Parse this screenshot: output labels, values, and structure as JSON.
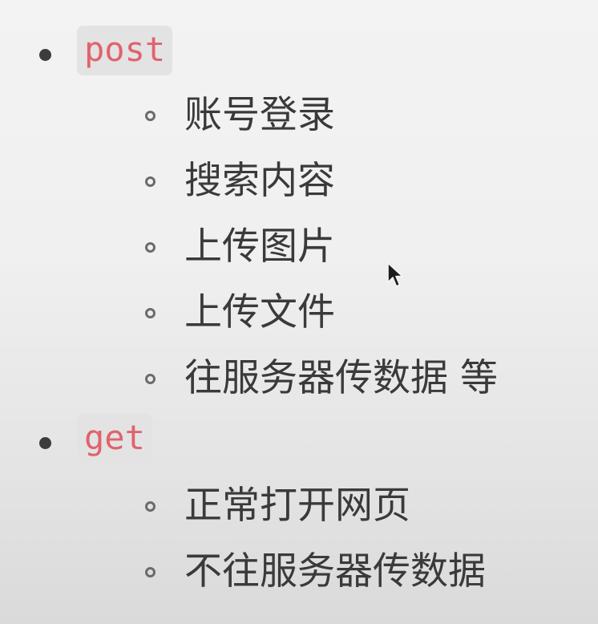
{
  "lists": [
    {
      "code": "post",
      "items": [
        "账号登录",
        "搜索内容",
        "上传图片",
        "上传文件",
        "往服务器传数据 等"
      ]
    },
    {
      "code": "get",
      "items": [
        "正常打开网页",
        "不往服务器传数据"
      ]
    }
  ],
  "colors": {
    "code_text": "#e0636d",
    "code_background": "#e3e3e3",
    "body_text": "#3a3a3a"
  },
  "icons": {
    "cursor": "mouse-pointer-icon"
  }
}
